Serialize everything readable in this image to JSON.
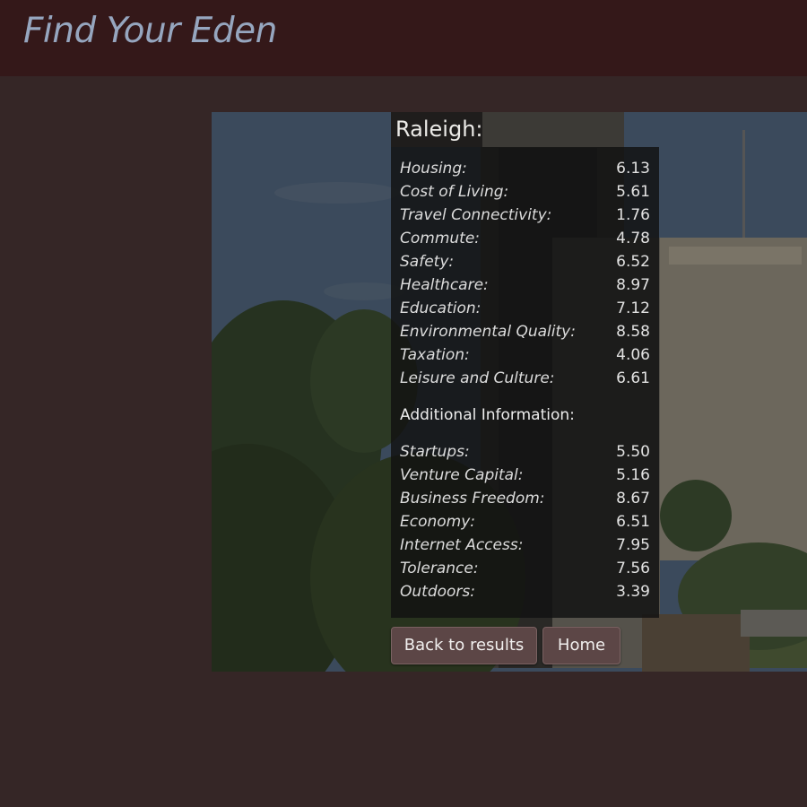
{
  "header": {
    "title": "Find Your Eden"
  },
  "city": {
    "name": "Raleigh:"
  },
  "scores": [
    {
      "label": "Housing:",
      "value": "6.13"
    },
    {
      "label": "Cost of Living:",
      "value": "5.61"
    },
    {
      "label": "Travel Connectivity:",
      "value": "1.76"
    },
    {
      "label": "Commute:",
      "value": "4.78"
    },
    {
      "label": "Safety:",
      "value": "6.52"
    },
    {
      "label": "Healthcare:",
      "value": "8.97"
    },
    {
      "label": "Education:",
      "value": "7.12"
    },
    {
      "label": "Environmental Quality:",
      "value": "8.58"
    },
    {
      "label": "Taxation:",
      "value": "4.06"
    },
    {
      "label": "Leisure and Culture:",
      "value": "6.61"
    }
  ],
  "additional": {
    "heading": "Additional Information:",
    "items": [
      {
        "label": "Startups:",
        "value": "5.50"
      },
      {
        "label": "Venture Capital:",
        "value": "5.16"
      },
      {
        "label": "Business Freedom:",
        "value": "8.67"
      },
      {
        "label": "Economy:",
        "value": "6.51"
      },
      {
        "label": "Internet Access:",
        "value": "7.95"
      },
      {
        "label": "Tolerance:",
        "value": "7.56"
      },
      {
        "label": "Outdoors:",
        "value": "3.39"
      }
    ]
  },
  "buttons": {
    "back": "Back to results",
    "home": "Home"
  },
  "colors": {
    "page_background": "#352626",
    "header_background": "#341819",
    "title_text": "#96a6bf",
    "button_background": "#5c4646"
  }
}
